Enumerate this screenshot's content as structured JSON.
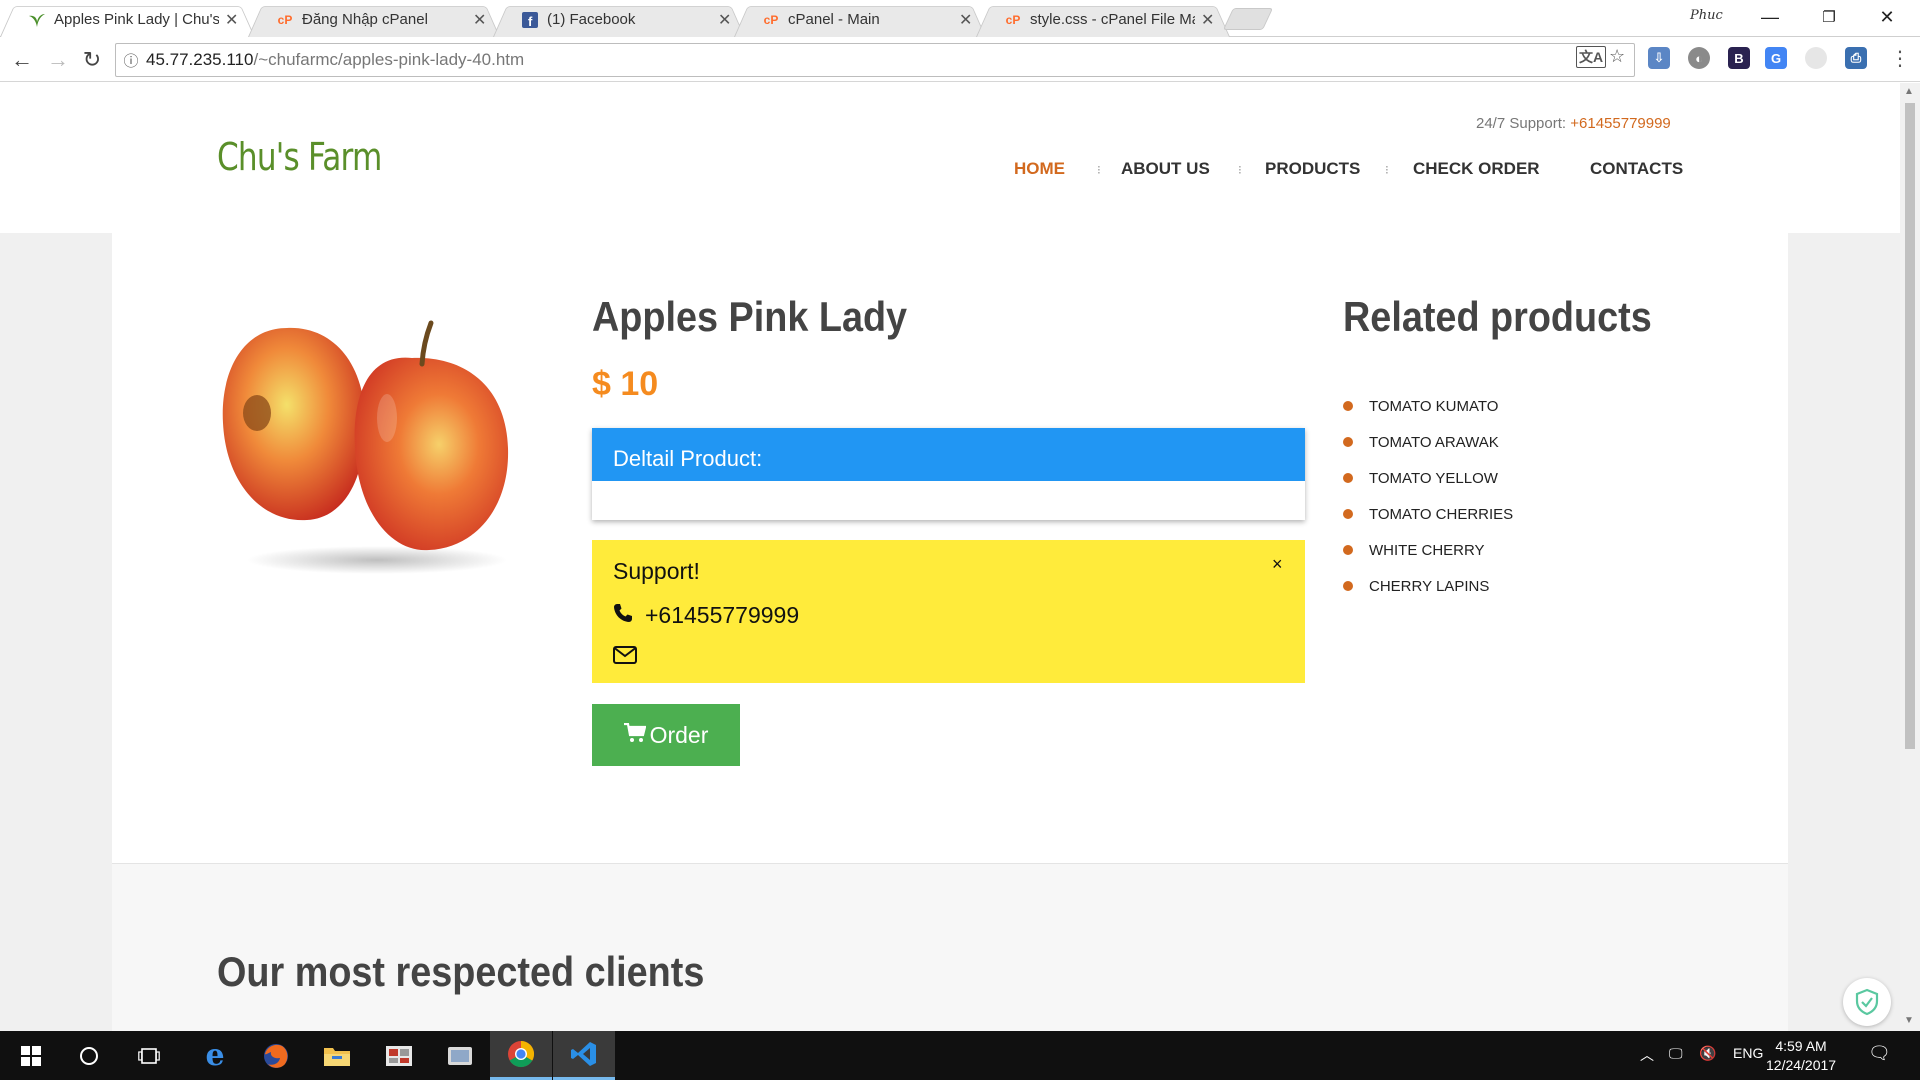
{
  "browser": {
    "tabs": [
      {
        "title": "Apples Pink Lady | Chu's",
        "favicon": "leaf-icon",
        "active": true
      },
      {
        "title": "Đăng Nhập cPanel",
        "favicon": "cpanel-icon",
        "active": false
      },
      {
        "title": "(1) Facebook",
        "favicon": "facebook-icon",
        "active": false
      },
      {
        "title": "cPanel - Main",
        "favicon": "cpanel-icon",
        "active": false
      },
      {
        "title": "style.css - cPanel File Mar",
        "favicon": "cpanel-icon",
        "active": false
      }
    ],
    "profile_name": "Phuc",
    "url_host": "45.77.235.110",
    "url_path": "/~chufarmc/apples-pink-lady-40.htm"
  },
  "site": {
    "logo": "Chu's Farm",
    "support_label": "24/7 Support:",
    "support_phone": "+61455779999",
    "nav": [
      {
        "label": "HOME",
        "active": true
      },
      {
        "label": "ABOUT US",
        "active": false
      },
      {
        "label": "PRODUCTS",
        "active": false
      },
      {
        "label": "CHECK ORDER",
        "active": false
      },
      {
        "label": "CONTACTS",
        "active": false
      }
    ]
  },
  "product": {
    "name": "Apples Pink Lady",
    "price": "$ 10",
    "detail_heading": "Deltail Product:",
    "support_title": "Support!",
    "support_close": "×",
    "support_phone": "+61455779999",
    "order_label": "Order"
  },
  "related": {
    "title": "Related products",
    "items": [
      "TOMATO KUMATO",
      "TOMATO ARAWAK",
      "TOMATO YELLOW",
      "TOMATO CHERRIES",
      "WHITE CHERRY",
      "CHERRY LAPINS"
    ]
  },
  "clients": {
    "title": "Our most respected clients"
  },
  "taskbar": {
    "language": "ENG",
    "time": "4:59 AM",
    "date": "12/24/2017"
  },
  "colors": {
    "accent_orange": "#d2691e",
    "price_orange": "#f58b1f",
    "detail_blue": "#2196f3",
    "support_yellow": "#ffeb3b",
    "order_green": "#4caf50",
    "logo_green": "#5a8f2a"
  }
}
